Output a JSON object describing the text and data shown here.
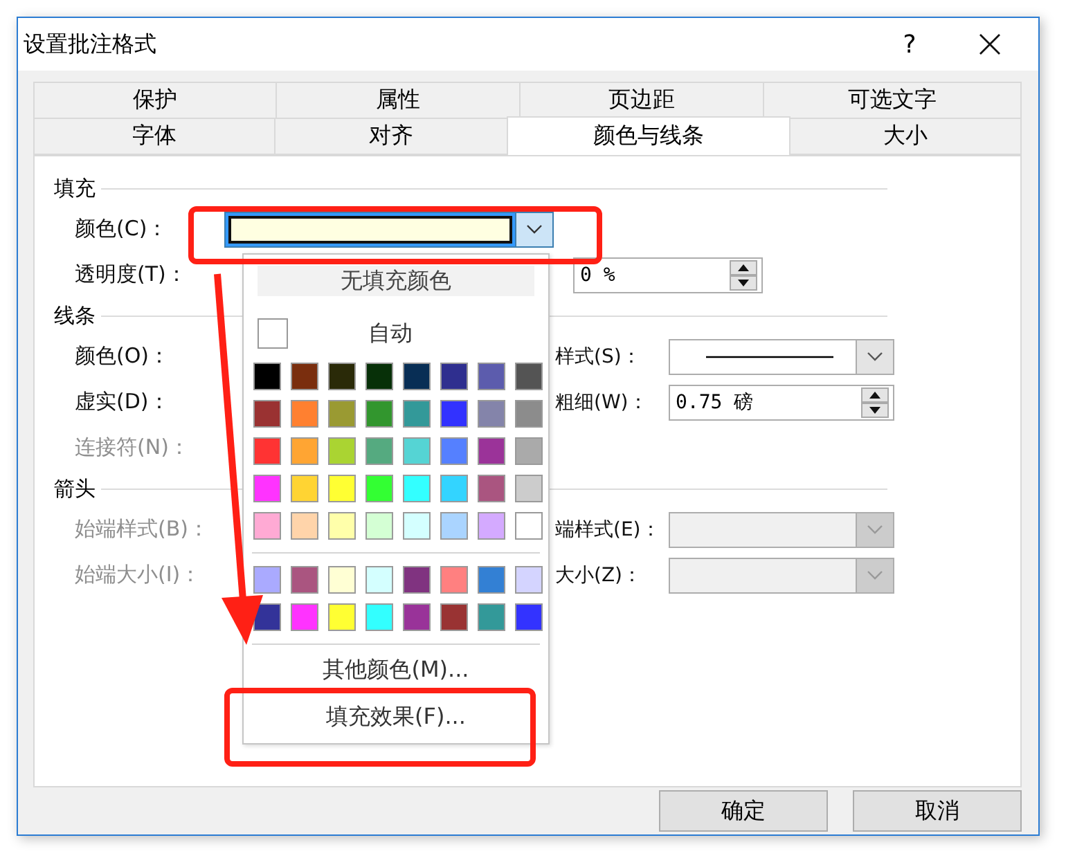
{
  "window": {
    "title": "设置批注格式",
    "help": "?"
  },
  "tab_rows": [
    [
      {
        "label": "保护",
        "selected": false
      },
      {
        "label": "属性",
        "selected": false
      },
      {
        "label": "页边距",
        "selected": false
      },
      {
        "label": "可选文字",
        "selected": false
      }
    ],
    [
      {
        "label": "字体",
        "selected": false
      },
      {
        "label": "对齐",
        "selected": false
      },
      {
        "label": "颜色与线条",
        "selected": true
      },
      {
        "label": "大小",
        "selected": false
      }
    ]
  ],
  "fill": {
    "heading": "填充",
    "color_label": "颜色(C)：",
    "color": "#ffffe1",
    "transparency_label": "透明度(T)：",
    "transparency_value": "0 %"
  },
  "line": {
    "heading": "线条",
    "color_label": "颜色(O)：",
    "dash_label": "虚实(D)：",
    "connector_label": "连接符(N)：",
    "connector_disabled": true,
    "style_label": "样式(S)：",
    "weight_label": "粗细(W)：",
    "weight_value": "0.75 磅"
  },
  "arrows": {
    "heading": "箭头",
    "disabled": true,
    "begin_style_label": "始端样式(B)：",
    "begin_size_label": "始端大小(I)：",
    "end_style_label": "端样式(E)：",
    "end_size_label": "大小(Z)："
  },
  "color_menu": {
    "no_fill": "无填充颜色",
    "auto": "自动",
    "swatch_groups": [
      [
        [
          {
            "color": "#000000"
          },
          {
            "color": "#7a2e0e"
          },
          {
            "color": "#2a2a08"
          },
          {
            "color": "#073008"
          },
          {
            "color": "#082e55"
          },
          {
            "color": "#2f2f8f"
          },
          {
            "color": "#5c5cad"
          },
          {
            "color": "#545454"
          }
        ],
        [
          {
            "color": "#9a3232"
          },
          {
            "color": "#ff8030"
          },
          {
            "color": "#9a9a32"
          },
          {
            "color": "#32962e"
          },
          {
            "color": "#339999"
          },
          {
            "color": "#3232ff"
          },
          {
            "color": "#8484aa"
          },
          {
            "color": "#8c8c8c"
          }
        ],
        [
          {
            "color": "#ff3333"
          },
          {
            "color": "#ffa533"
          },
          {
            "color": "#aad432"
          },
          {
            "color": "#55aa80"
          },
          {
            "color": "#55d4d4"
          },
          {
            "color": "#5580ff"
          },
          {
            "color": "#9b3399"
          },
          {
            "color": "#aaaaaa"
          }
        ],
        [
          {
            "color": "#ff33ff"
          },
          {
            "color": "#ffd433"
          },
          {
            "color": "#ffff33"
          },
          {
            "color": "#33ff33"
          },
          {
            "color": "#33ffff"
          },
          {
            "color": "#33d4ff"
          },
          {
            "color": "#aa5580"
          },
          {
            "color": "#cccccc"
          }
        ],
        [
          {
            "color": "#ffaad4"
          },
          {
            "color": "#ffd4aa"
          },
          {
            "color": "#ffffaa"
          },
          {
            "color": "#d4ffd4"
          },
          {
            "color": "#d4ffff"
          },
          {
            "color": "#aad4ff"
          },
          {
            "color": "#d4aaff"
          },
          {
            "color": "#ffffff"
          }
        ]
      ],
      [
        [
          {
            "color": "#aaaaff"
          },
          {
            "color": "#aa5580"
          },
          {
            "color": "#ffffd4"
          },
          {
            "color": "#d4ffff"
          },
          {
            "color": "#803380"
          },
          {
            "color": "#ff8080"
          },
          {
            "color": "#3380d4"
          },
          {
            "color": "#d4d4ff"
          }
        ],
        [
          {
            "color": "#333399"
          },
          {
            "color": "#ff33ff"
          },
          {
            "color": "#ffff33"
          },
          {
            "color": "#33ffff"
          },
          {
            "color": "#993399"
          },
          {
            "color": "#993333"
          },
          {
            "color": "#339999"
          },
          {
            "color": "#3333ff"
          }
        ]
      ]
    ],
    "more_colors": "其他颜色(M)...",
    "fill_effects": "填充效果(F)..."
  },
  "buttons": [
    {
      "label": "确定"
    },
    {
      "label": "取消"
    }
  ]
}
